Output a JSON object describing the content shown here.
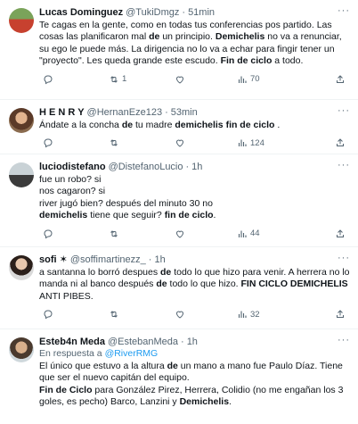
{
  "icons": {
    "reply": "reply-icon",
    "retweet": "retweet-icon",
    "like": "like-icon",
    "views": "views-icon",
    "share": "share-icon",
    "more": "more-icon"
  },
  "tweets": [
    {
      "name": "Lucas Dominguez",
      "handle": "@TukiDmgz",
      "sep": "·",
      "time": "51min",
      "more": "···",
      "retweets": "1",
      "views": "70",
      "segments": [
        {
          "t": "Te cagas en la gente, como en todas tus conferencias pos partido. Las cosas las planificaron mal ",
          "b": false
        },
        {
          "t": "de",
          "b": true
        },
        {
          "t": " un principio. ",
          "b": false
        },
        {
          "t": "Demichelis",
          "b": true
        },
        {
          "t": " no va a renunciar, su ego le puede más. La dirigencia no lo va a echar para fingir tener un \"proyecto\". Les queda grande este escudo. ",
          "b": false
        },
        {
          "t": "Fin de ciclo",
          "b": true
        },
        {
          "t": " a todo.",
          "b": false
        }
      ]
    },
    {
      "name": "H E N R Y",
      "handle": "@HernanEze123",
      "sep": "·",
      "time": "53min",
      "more": "···",
      "retweets": "",
      "views": "124",
      "segments": [
        {
          "t": "Ándate a la concha ",
          "b": false
        },
        {
          "t": "de",
          "b": true
        },
        {
          "t": " tu madre ",
          "b": false
        },
        {
          "t": "demichelis fin de ciclo",
          "b": true
        },
        {
          "t": " .",
          "b": false
        }
      ]
    },
    {
      "name": "luciodistefano",
      "handle": "@DistefanoLucio",
      "sep": "·",
      "time": "1h",
      "more": "···",
      "retweets": "",
      "views": "44",
      "segments": [
        {
          "t": "fue un robo? si\nnos cagaron? si\nriver jugó bien? después del minuto 30 no\n",
          "b": false
        },
        {
          "t": "demichelis",
          "b": true
        },
        {
          "t": " tiene que seguir? ",
          "b": false
        },
        {
          "t": "fin de ciclo",
          "b": true
        },
        {
          "t": ".",
          "b": false
        }
      ]
    },
    {
      "name": "sofi ✶",
      "handle": "@soffimartinezz_",
      "sep": "·",
      "time": "1h",
      "more": "···",
      "retweets": "",
      "views": "32",
      "segments": [
        {
          "t": "a santanna lo borró despues ",
          "b": false
        },
        {
          "t": "de",
          "b": true
        },
        {
          "t": " todo lo que hizo para venir. A herrera no lo manda ni al banco después ",
          "b": false
        },
        {
          "t": "de",
          "b": true
        },
        {
          "t": " todo lo que hizo. ",
          "b": false
        },
        {
          "t": "FIN CICLO DEMICHELIS",
          "b": true
        },
        {
          "t": " ANTI PIBES.",
          "b": false
        }
      ]
    },
    {
      "name": "Esteb4n Meda",
      "handle": "@EstebanMeda",
      "sep": "·",
      "time": "1h",
      "more": "···",
      "reply_prefix": "En respuesta a",
      "reply_to": "@RiverRMG",
      "retweets": "",
      "views": "",
      "segments": [
        {
          "t": "El único que estuvo a la altura ",
          "b": false
        },
        {
          "t": "de",
          "b": true
        },
        {
          "t": " un mano a mano fue Paulo Díaz. Tiene que ser el nuevo capitán del equipo.\n",
          "b": false
        },
        {
          "t": "Fin de Ciclo",
          "b": true
        },
        {
          "t": " para González Pirez, Herrera, Colidio (no me engañan los 3 goles, es pecho) Barco, Lanzini y ",
          "b": false
        },
        {
          "t": "Demichelis",
          "b": true
        },
        {
          "t": ".",
          "b": false
        }
      ]
    }
  ]
}
